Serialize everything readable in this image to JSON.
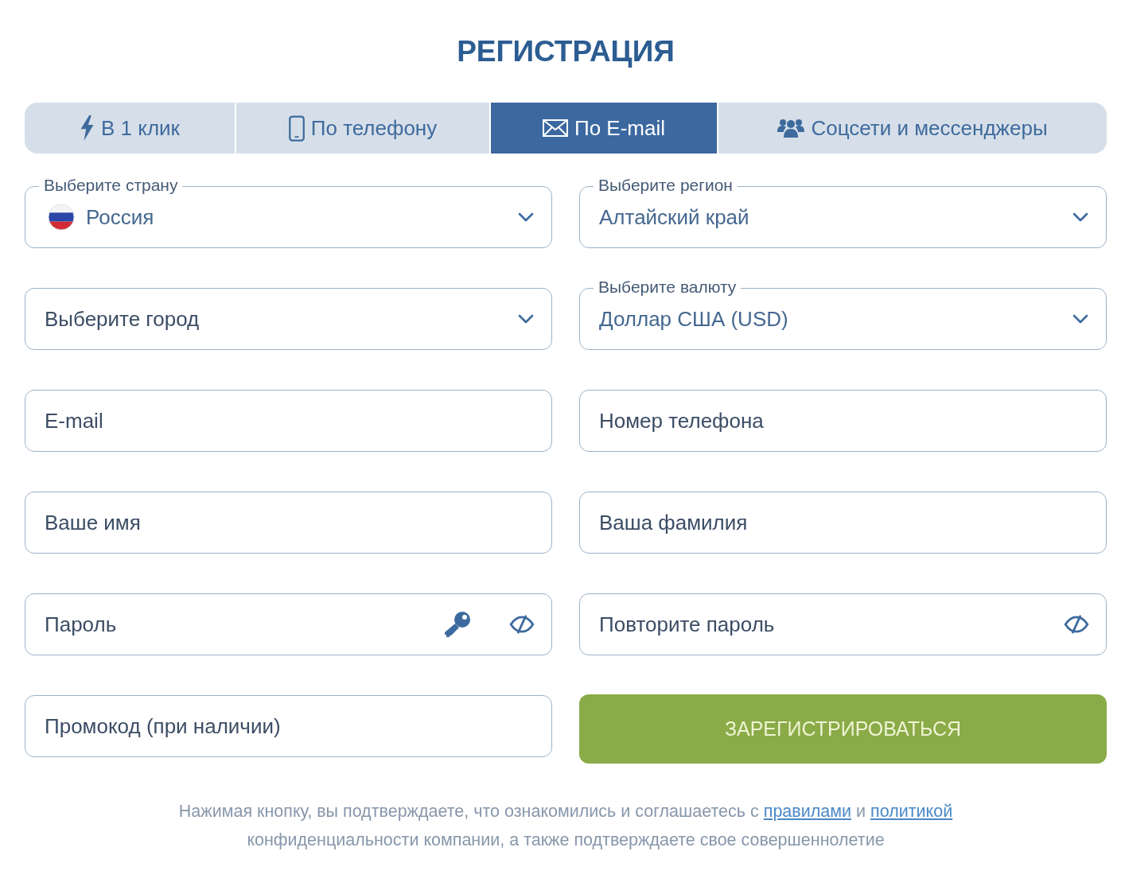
{
  "title": "РЕГИСТРАЦИЯ",
  "tabs": [
    {
      "label": "В 1 клик",
      "selected": false
    },
    {
      "label": "По телефону",
      "selected": false
    },
    {
      "label": "По E-mail",
      "selected": true
    },
    {
      "label": "Соцсети и мессенджеры",
      "selected": false
    }
  ],
  "rows": [
    [
      {
        "kind": "country",
        "legend": "Выберите страну",
        "value": "Россия"
      },
      {
        "kind": "select",
        "legend": "Выберите регион",
        "value": "Алтайский край"
      }
    ],
    [
      {
        "kind": "select",
        "placeholder": "Выберите город"
      },
      {
        "kind": "select",
        "legend": "Выберите валюту",
        "value": "Доллар США (USD)"
      }
    ],
    [
      {
        "kind": "text",
        "placeholder": "E-mail"
      },
      {
        "kind": "text",
        "placeholder": "Номер телефона"
      }
    ],
    [
      {
        "kind": "text",
        "placeholder": "Ваше имя"
      },
      {
        "kind": "text",
        "placeholder": "Ваша фамилия"
      }
    ],
    [
      {
        "kind": "password-key",
        "placeholder": "Пароль"
      },
      {
        "kind": "password",
        "placeholder": "Повторите пароль"
      }
    ],
    [
      {
        "kind": "text",
        "placeholder": "Промокод (при наличии)"
      },
      {
        "kind": "submit",
        "label": "ЗАРЕГИСТРИРОВАТЬСЯ"
      }
    ]
  ],
  "notice": [
    {
      "kind": "text",
      "text": "Нажимая кнопку, вы подтверждаете, что ознакомились и соглашаетесь с "
    },
    {
      "kind": "link",
      "text": "правилами"
    },
    {
      "kind": "text",
      "text": " и "
    },
    {
      "kind": "link",
      "text": "политикой"
    },
    {
      "kind": "text",
      "text": " конфиденциальности компании, а также подтверждаете свое совершеннолетие"
    }
  ]
}
